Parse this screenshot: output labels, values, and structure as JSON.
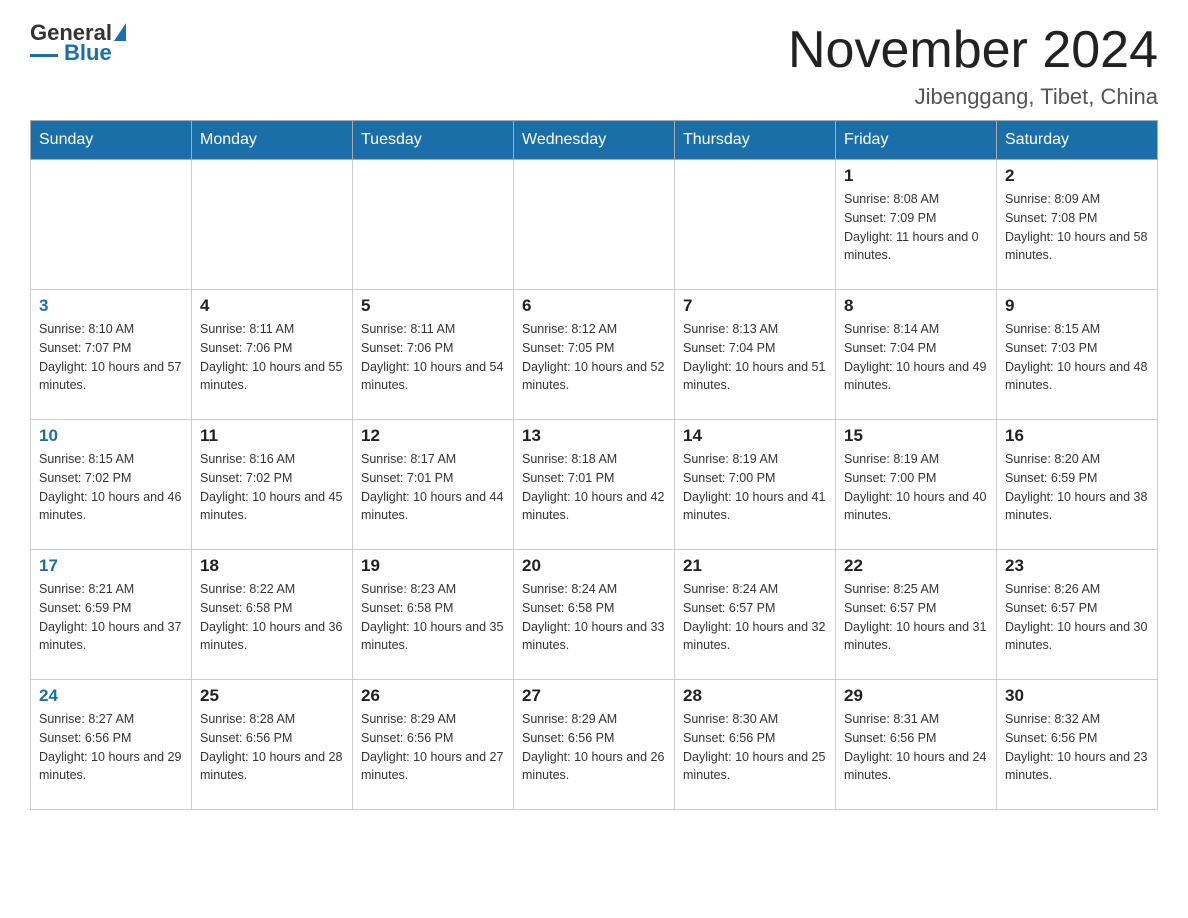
{
  "logo": {
    "general": "General",
    "blue": "Blue"
  },
  "title": "November 2024",
  "location": "Jibenggang, Tibet, China",
  "days_of_week": [
    "Sunday",
    "Monday",
    "Tuesday",
    "Wednesday",
    "Thursday",
    "Friday",
    "Saturday"
  ],
  "weeks": [
    [
      null,
      null,
      null,
      null,
      null,
      {
        "day": 1,
        "sunrise": "Sunrise: 8:08 AM",
        "sunset": "Sunset: 7:09 PM",
        "daylight": "Daylight: 11 hours and 0 minutes."
      },
      {
        "day": 2,
        "sunrise": "Sunrise: 8:09 AM",
        "sunset": "Sunset: 7:08 PM",
        "daylight": "Daylight: 10 hours and 58 minutes."
      }
    ],
    [
      {
        "day": 3,
        "sunrise": "Sunrise: 8:10 AM",
        "sunset": "Sunset: 7:07 PM",
        "daylight": "Daylight: 10 hours and 57 minutes."
      },
      {
        "day": 4,
        "sunrise": "Sunrise: 8:11 AM",
        "sunset": "Sunset: 7:06 PM",
        "daylight": "Daylight: 10 hours and 55 minutes."
      },
      {
        "day": 5,
        "sunrise": "Sunrise: 8:11 AM",
        "sunset": "Sunset: 7:06 PM",
        "daylight": "Daylight: 10 hours and 54 minutes."
      },
      {
        "day": 6,
        "sunrise": "Sunrise: 8:12 AM",
        "sunset": "Sunset: 7:05 PM",
        "daylight": "Daylight: 10 hours and 52 minutes."
      },
      {
        "day": 7,
        "sunrise": "Sunrise: 8:13 AM",
        "sunset": "Sunset: 7:04 PM",
        "daylight": "Daylight: 10 hours and 51 minutes."
      },
      {
        "day": 8,
        "sunrise": "Sunrise: 8:14 AM",
        "sunset": "Sunset: 7:04 PM",
        "daylight": "Daylight: 10 hours and 49 minutes."
      },
      {
        "day": 9,
        "sunrise": "Sunrise: 8:15 AM",
        "sunset": "Sunset: 7:03 PM",
        "daylight": "Daylight: 10 hours and 48 minutes."
      }
    ],
    [
      {
        "day": 10,
        "sunrise": "Sunrise: 8:15 AM",
        "sunset": "Sunset: 7:02 PM",
        "daylight": "Daylight: 10 hours and 46 minutes."
      },
      {
        "day": 11,
        "sunrise": "Sunrise: 8:16 AM",
        "sunset": "Sunset: 7:02 PM",
        "daylight": "Daylight: 10 hours and 45 minutes."
      },
      {
        "day": 12,
        "sunrise": "Sunrise: 8:17 AM",
        "sunset": "Sunset: 7:01 PM",
        "daylight": "Daylight: 10 hours and 44 minutes."
      },
      {
        "day": 13,
        "sunrise": "Sunrise: 8:18 AM",
        "sunset": "Sunset: 7:01 PM",
        "daylight": "Daylight: 10 hours and 42 minutes."
      },
      {
        "day": 14,
        "sunrise": "Sunrise: 8:19 AM",
        "sunset": "Sunset: 7:00 PM",
        "daylight": "Daylight: 10 hours and 41 minutes."
      },
      {
        "day": 15,
        "sunrise": "Sunrise: 8:19 AM",
        "sunset": "Sunset: 7:00 PM",
        "daylight": "Daylight: 10 hours and 40 minutes."
      },
      {
        "day": 16,
        "sunrise": "Sunrise: 8:20 AM",
        "sunset": "Sunset: 6:59 PM",
        "daylight": "Daylight: 10 hours and 38 minutes."
      }
    ],
    [
      {
        "day": 17,
        "sunrise": "Sunrise: 8:21 AM",
        "sunset": "Sunset: 6:59 PM",
        "daylight": "Daylight: 10 hours and 37 minutes."
      },
      {
        "day": 18,
        "sunrise": "Sunrise: 8:22 AM",
        "sunset": "Sunset: 6:58 PM",
        "daylight": "Daylight: 10 hours and 36 minutes."
      },
      {
        "day": 19,
        "sunrise": "Sunrise: 8:23 AM",
        "sunset": "Sunset: 6:58 PM",
        "daylight": "Daylight: 10 hours and 35 minutes."
      },
      {
        "day": 20,
        "sunrise": "Sunrise: 8:24 AM",
        "sunset": "Sunset: 6:58 PM",
        "daylight": "Daylight: 10 hours and 33 minutes."
      },
      {
        "day": 21,
        "sunrise": "Sunrise: 8:24 AM",
        "sunset": "Sunset: 6:57 PM",
        "daylight": "Daylight: 10 hours and 32 minutes."
      },
      {
        "day": 22,
        "sunrise": "Sunrise: 8:25 AM",
        "sunset": "Sunset: 6:57 PM",
        "daylight": "Daylight: 10 hours and 31 minutes."
      },
      {
        "day": 23,
        "sunrise": "Sunrise: 8:26 AM",
        "sunset": "Sunset: 6:57 PM",
        "daylight": "Daylight: 10 hours and 30 minutes."
      }
    ],
    [
      {
        "day": 24,
        "sunrise": "Sunrise: 8:27 AM",
        "sunset": "Sunset: 6:56 PM",
        "daylight": "Daylight: 10 hours and 29 minutes."
      },
      {
        "day": 25,
        "sunrise": "Sunrise: 8:28 AM",
        "sunset": "Sunset: 6:56 PM",
        "daylight": "Daylight: 10 hours and 28 minutes."
      },
      {
        "day": 26,
        "sunrise": "Sunrise: 8:29 AM",
        "sunset": "Sunset: 6:56 PM",
        "daylight": "Daylight: 10 hours and 27 minutes."
      },
      {
        "day": 27,
        "sunrise": "Sunrise: 8:29 AM",
        "sunset": "Sunset: 6:56 PM",
        "daylight": "Daylight: 10 hours and 26 minutes."
      },
      {
        "day": 28,
        "sunrise": "Sunrise: 8:30 AM",
        "sunset": "Sunset: 6:56 PM",
        "daylight": "Daylight: 10 hours and 25 minutes."
      },
      {
        "day": 29,
        "sunrise": "Sunrise: 8:31 AM",
        "sunset": "Sunset: 6:56 PM",
        "daylight": "Daylight: 10 hours and 24 minutes."
      },
      {
        "day": 30,
        "sunrise": "Sunrise: 8:32 AM",
        "sunset": "Sunset: 6:56 PM",
        "daylight": "Daylight: 10 hours and 23 minutes."
      }
    ]
  ]
}
